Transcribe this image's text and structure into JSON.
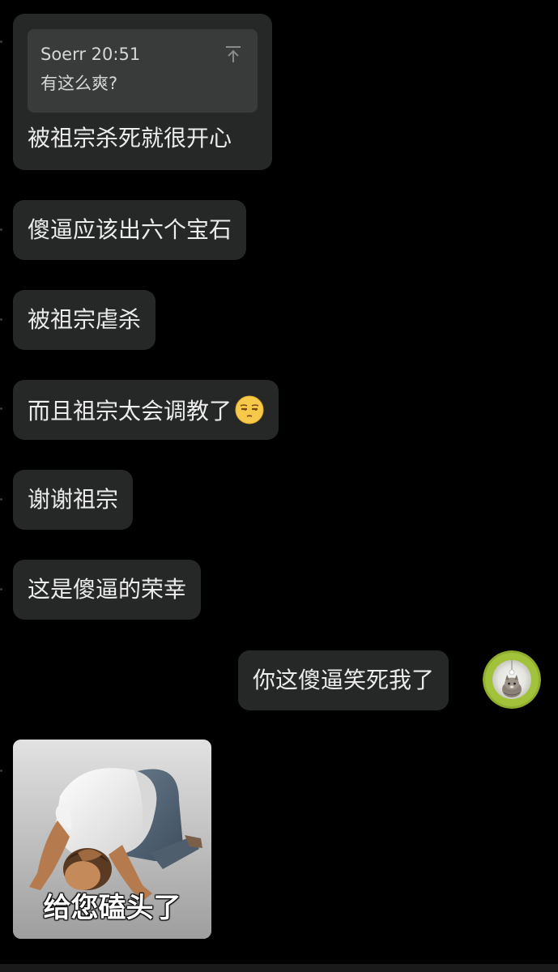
{
  "messages": [
    {
      "quote": {
        "author_time": "Soerr 20:51",
        "text": "有这么爽?"
      },
      "text": "被祖宗杀死就很开心"
    },
    {
      "text": "傻逼应该出六个宝石"
    },
    {
      "text": "被祖宗虐杀"
    },
    {
      "text": "而且祖宗太会调教了",
      "emoji": "unamused-face-emoji"
    },
    {
      "text": "谢谢祖宗"
    },
    {
      "text": "这是傻逼的荣幸"
    },
    {
      "text": "你这傻逼笑死我了",
      "side": "right"
    },
    {
      "sticker_caption": "给您磕头了",
      "sticker": "kneeling-man-kowtow-sticker"
    }
  ],
  "avatar": "cat-in-green-ring-avatar",
  "colors": {
    "background": "#000000",
    "bubble": "#262727",
    "quote_box": "#393A3A",
    "text": "#ECECEC",
    "avatar_ring": "#9DB93A"
  }
}
